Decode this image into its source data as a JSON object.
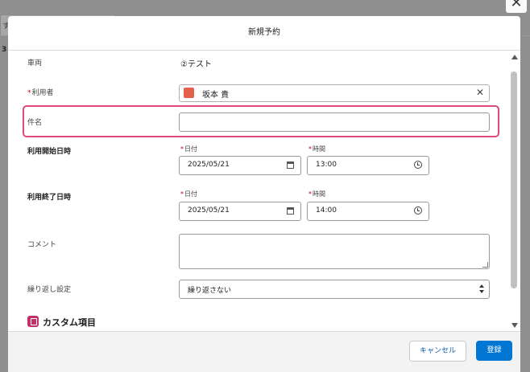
{
  "background": {
    "tab_text": "す",
    "row_text": "3"
  },
  "modal": {
    "title": "新規予約",
    "close_glyph": "✕"
  },
  "fields": {
    "vehicle": {
      "label": "車両",
      "value": "②テスト"
    },
    "user": {
      "label": "利用者",
      "required": "*",
      "value": "坂本 貴",
      "clear_glyph": "✕"
    },
    "subject": {
      "label": "件名",
      "value": ""
    },
    "start": {
      "label": "利用開始日時",
      "date_label": "日付",
      "date_value": "2025/05/21",
      "time_label": "時間",
      "time_value": "13:00"
    },
    "end": {
      "label": "利用終了日時",
      "date_label": "日付",
      "date_value": "2025/05/21",
      "time_label": "時間",
      "time_value": "14:00"
    },
    "comment": {
      "label": "コメント",
      "value": ""
    },
    "repeat": {
      "label": "繰り返し設定",
      "selected": "繰り返さない"
    }
  },
  "section": {
    "title": "カスタム項目"
  },
  "footer": {
    "cancel_label": "キャンセル",
    "save_label": "登録"
  },
  "colors": {
    "primary": "#0176d3",
    "highlight": "#e0487e",
    "required": "#ba0517",
    "avatar": "#e3604a",
    "section_icon": "#c23268"
  },
  "icons": {
    "avatar": "user-avatar-icon",
    "calendar": "calendar-icon",
    "clock": "clock-icon",
    "section": "custom-items-icon",
    "close": "close-icon",
    "select": "updown-arrows-icon"
  }
}
